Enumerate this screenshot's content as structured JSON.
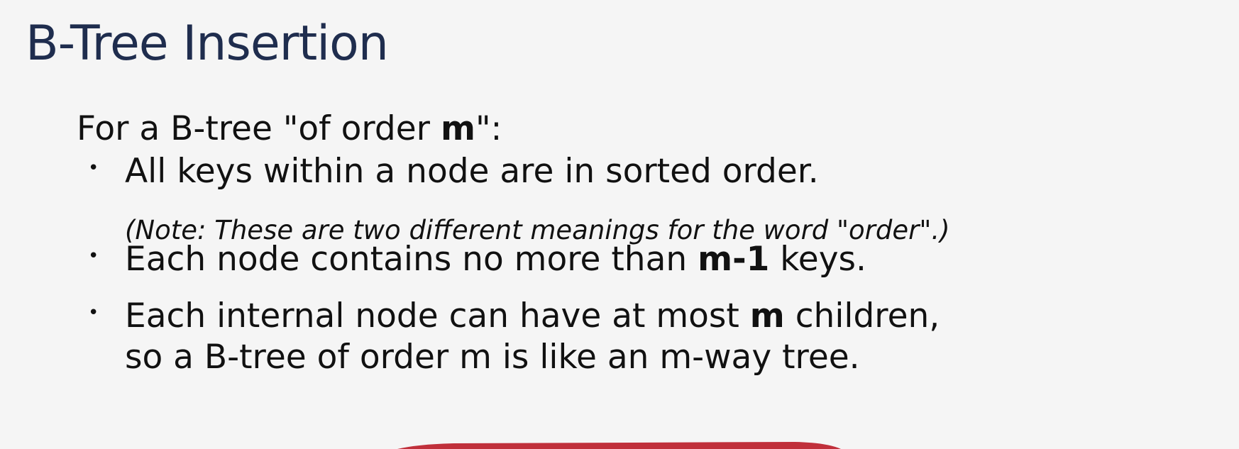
{
  "slide": {
    "title": "B-Tree Insertion",
    "intro": {
      "before": "For a B-tree \"of order ",
      "bold": "m",
      "after": "\":"
    },
    "bullet_char": "•",
    "bullets": [
      {
        "text": "All keys within a node are in sorted order.",
        "note": "(Note: These are two different meanings for the word \"order\".)"
      },
      {
        "before": "Each node contains no more than ",
        "bold": "m-1",
        "after": " keys."
      },
      {
        "line1_before": "Each internal node can have at most ",
        "line1_bold": "m",
        "line1_after": " children,",
        "line2": "so a B-tree of order m is like an m-way tree."
      }
    ]
  },
  "colors": {
    "title": "#1f2d4e",
    "text": "#111111",
    "background": "#f5f5f5",
    "annotation": "#c0303b"
  }
}
